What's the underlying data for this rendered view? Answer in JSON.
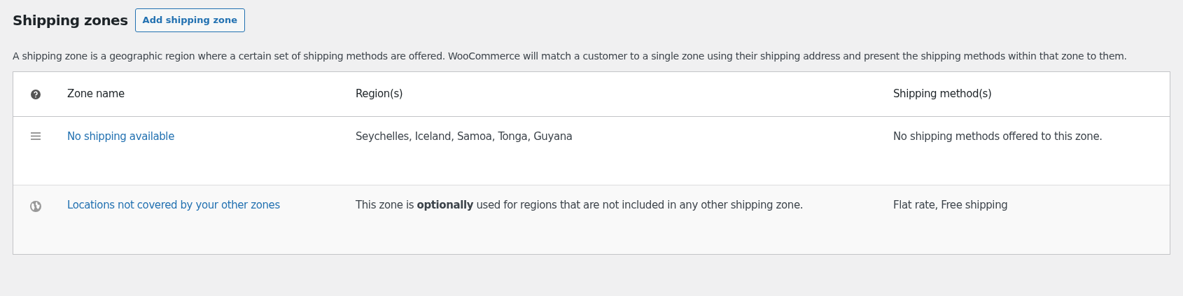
{
  "heading": "Shipping zones",
  "add_button": "Add shipping zone",
  "description": "A shipping zone is a geographic region where a certain set of shipping methods are offered. WooCommerce will match a customer to a single zone using their shipping address and present the shipping methods within that zone to them.",
  "table": {
    "columns": [
      "Zone name",
      "Region(s)",
      "Shipping method(s)"
    ],
    "rows": [
      {
        "kind": "sortable",
        "zone_name": "No shipping available",
        "regions": "Seychelles, Iceland, Samoa, Tonga, Guyana",
        "methods": "No shipping methods offered to this zone."
      },
      {
        "kind": "fallback",
        "zone_name": "Locations not covered by your other zones",
        "regions": "This zone is **optionally** used for regions that are not included in any other shipping zone.",
        "methods": "Flat rate, Free shipping"
      }
    ]
  }
}
